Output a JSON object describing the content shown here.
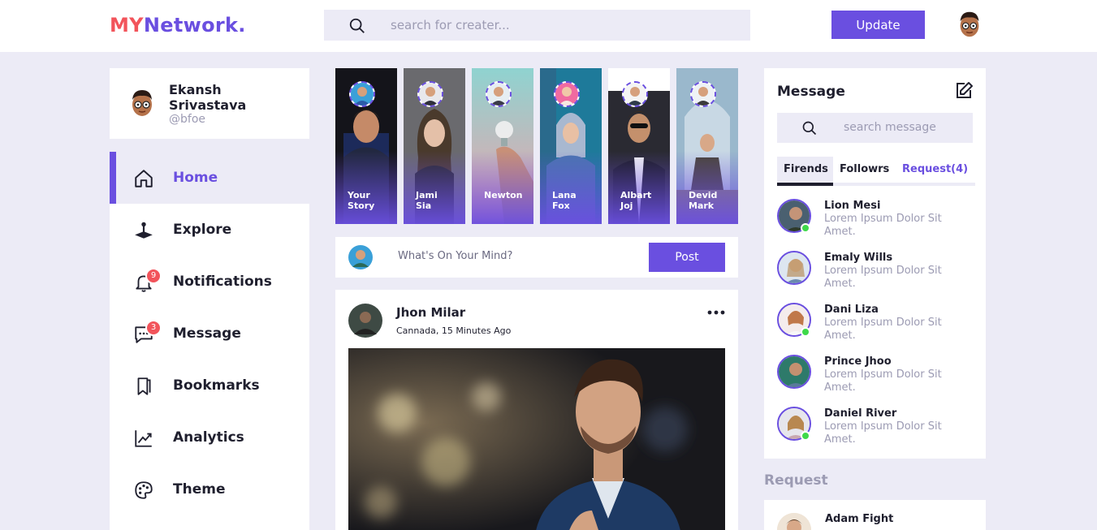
{
  "logo": {
    "part1": "MY",
    "part2": "Network."
  },
  "header": {
    "search_placeholder": "search for creater...",
    "update_label": "Update"
  },
  "profile": {
    "name": "Ekansh Srivastava",
    "handle": "@bfoe"
  },
  "menu": [
    {
      "label": "Home",
      "icon": "home-icon",
      "active": true
    },
    {
      "label": "Explore",
      "icon": "joystick-icon"
    },
    {
      "label": "Notifications",
      "icon": "bell-icon",
      "badge": "9"
    },
    {
      "label": "Message",
      "icon": "chat-icon",
      "badge": "3"
    },
    {
      "label": "Bookmarks",
      "icon": "bookmark-icon"
    },
    {
      "label": "Analytics",
      "icon": "chart-line-icon"
    },
    {
      "label": "Theme",
      "icon": "palette-icon"
    }
  ],
  "stories": [
    {
      "line1": "Your",
      "line2": "Story"
    },
    {
      "line1": "Jami",
      "line2": "Sia"
    },
    {
      "line1": "Newton",
      "line2": ""
    },
    {
      "line1": "Lana",
      "line2": "Fox"
    },
    {
      "line1": "Albart",
      "line2": "Joj"
    },
    {
      "line1": "Devid",
      "line2": "Mark"
    }
  ],
  "composer": {
    "placeholder": "What's On Your Mind?",
    "post_label": "Post"
  },
  "feed": {
    "author": "Jhon Milar",
    "meta": "Cannada, 15 Minutes Ago"
  },
  "messages": {
    "title": "Message",
    "search_placeholder": "search message",
    "tabs": [
      "Firends",
      "Followrs",
      "Request(4)"
    ],
    "contacts": [
      {
        "name": "Lion Mesi",
        "line1": "Lorem Ipsum Dolor Sit",
        "line2": "Amet.",
        "online": true
      },
      {
        "name": "Emaly Wills",
        "line1": "Lorem Ipsum Dolor Sit",
        "line2": "Amet.",
        "online": false
      },
      {
        "name": "Dani Liza",
        "line1": "Lorem Ipsum Dolor Sit",
        "line2": "Amet.",
        "online": true
      },
      {
        "name": "Prince Jhoo",
        "line1": "Lorem Ipsum Dolor Sit",
        "line2": "Amet.",
        "online": false
      },
      {
        "name": "Daniel River",
        "line1": "Lorem Ipsum Dolor Sit",
        "line2": "Amet.",
        "online": true
      }
    ]
  },
  "request": {
    "title": "Request",
    "first_name": "Adam Fight"
  },
  "colors": {
    "accent": "#6a4fe0",
    "logo_red": "#f2545b",
    "background": "#ecebf6",
    "online": "#3ed94a"
  }
}
